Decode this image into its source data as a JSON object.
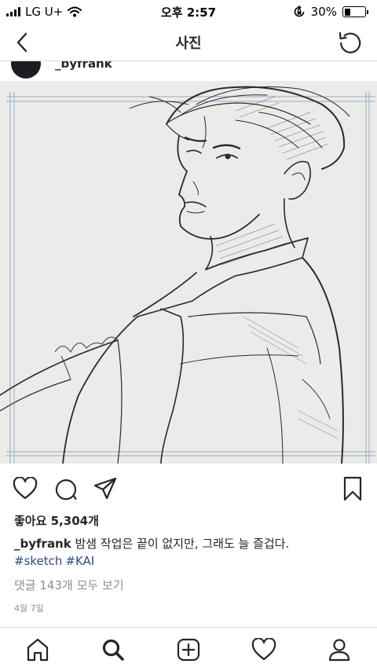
{
  "status_bar": {
    "carrier": "LG U+",
    "time": "오후 2:57",
    "battery": "30%",
    "battery_level": 0.3,
    "icons": [
      "signal-icon",
      "wifi-icon",
      "rotation-lock-icon",
      "battery-icon"
    ]
  },
  "header": {
    "title": "사진",
    "back_icon": "chevron-left-icon",
    "refresh_icon": "refresh-icon"
  },
  "post": {
    "username": "_byfrank",
    "image_alt_icon": "pencil-sketch-illustration",
    "likes": "좋아요 5,304개",
    "caption_user": "_byfrank",
    "caption_text": "밤샘 작업은 끝이 없지만, 그래도 늘 즐겁다.",
    "hashtags": [
      "#sketch",
      "#KAI"
    ],
    "comments_link": "댓글 143개 모두 보기",
    "date": "4월 7일"
  },
  "actions": [
    "heart-icon",
    "comment-icon",
    "share-icon",
    "bookmark-icon"
  ],
  "tabbar": [
    "home-icon",
    "search-icon",
    "add-post-icon",
    "activity-icon",
    "profile-icon"
  ]
}
